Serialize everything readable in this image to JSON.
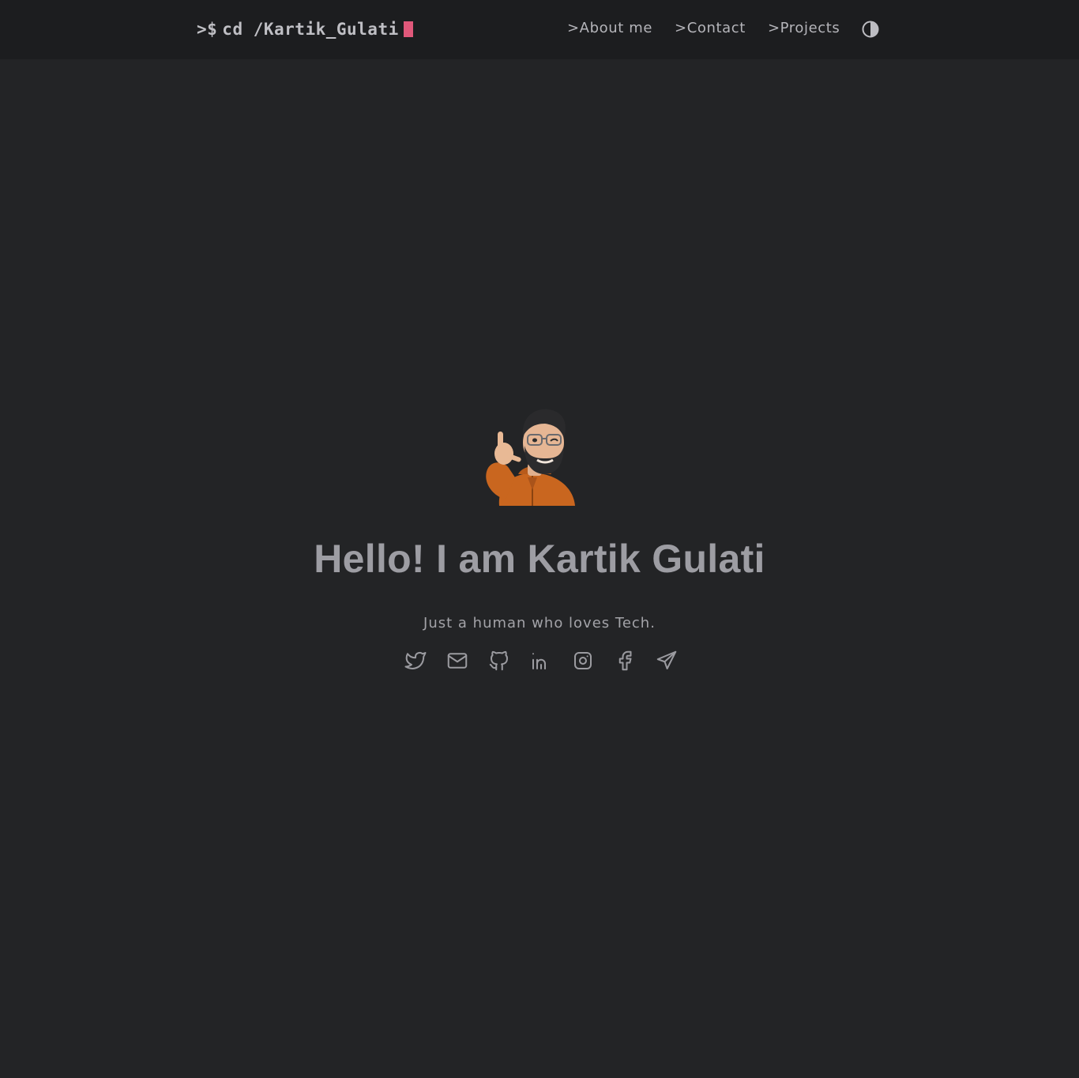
{
  "header": {
    "prompt": ">$",
    "command": "cd /Kartik_Gulati",
    "nav": [
      {
        "label": ">About me"
      },
      {
        "label": ">Contact"
      },
      {
        "label": ">Projects"
      }
    ],
    "theme_toggle_icon": "contrast-icon",
    "cursor_color": "#e0587a"
  },
  "hero": {
    "avatar_icon": "memoji-avatar",
    "headline": "Hello! I am Kartik Gulati",
    "tagline": "Just a human who loves Tech.",
    "socials": [
      {
        "icon": "twitter-icon"
      },
      {
        "icon": "mail-icon"
      },
      {
        "icon": "github-icon"
      },
      {
        "icon": "linkedin-icon"
      },
      {
        "icon": "instagram-icon"
      },
      {
        "icon": "facebook-icon"
      },
      {
        "icon": "telegram-icon"
      }
    ]
  },
  "colors": {
    "background": "#232426",
    "header_background": "#1c1d1f",
    "text": "#a6a6ab"
  }
}
